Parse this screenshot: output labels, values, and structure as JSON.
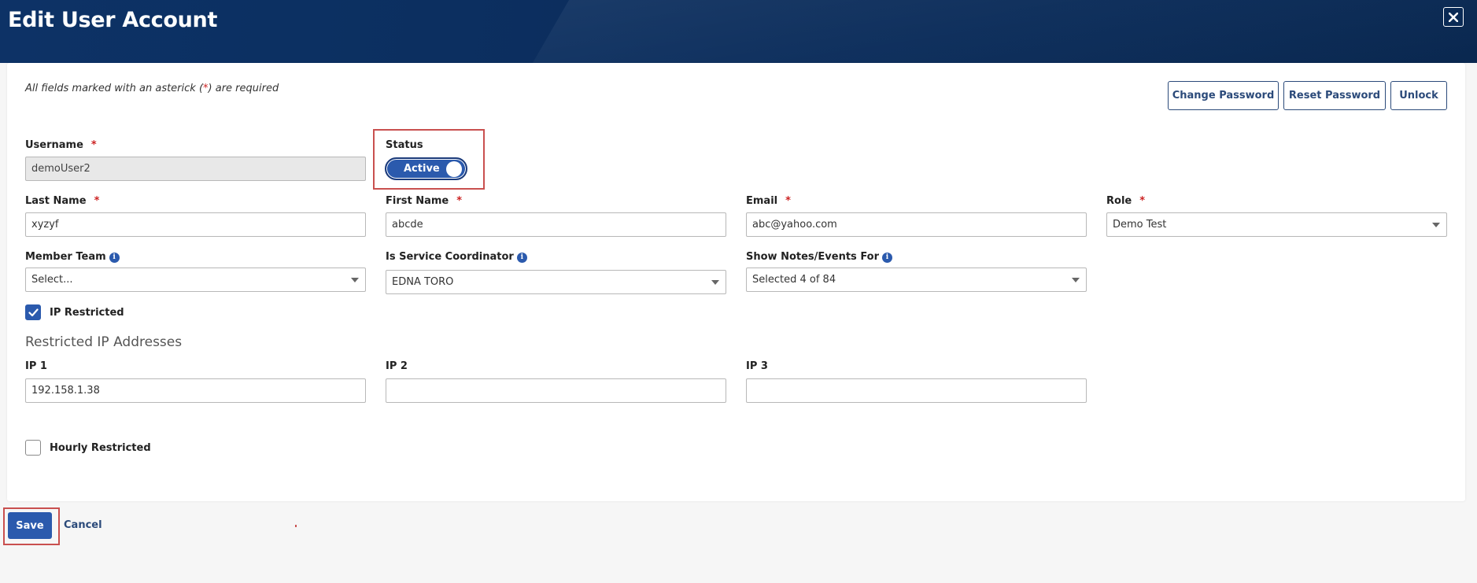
{
  "dialog": {
    "title": "Edit User Account"
  },
  "note": {
    "prefix": "All fields marked with an asterick (",
    "asterisk": "*",
    "suffix": ") are required"
  },
  "actions": {
    "change_password": "Change Password",
    "reset_password": "Reset Password",
    "unlock": "Unlock"
  },
  "fields": {
    "username": {
      "label": "Username",
      "value": "demoUser2"
    },
    "status": {
      "label": "Status",
      "value": "Active"
    },
    "last_name": {
      "label": "Last Name",
      "value": "xyzyf"
    },
    "first_name": {
      "label": "First Name",
      "value": "abcde"
    },
    "email": {
      "label": "Email",
      "value": "abc@yahoo.com"
    },
    "role": {
      "label": "Role",
      "value": "Demo Test"
    },
    "member_team": {
      "label": "Member Team",
      "value": "Select..."
    },
    "service_coordinator": {
      "label": "Is Service Coordinator",
      "value": "EDNA TORO"
    },
    "show_notes": {
      "label": "Show Notes/Events For",
      "value": "Selected 4 of 84"
    },
    "ip_restricted": {
      "label": "IP Restricted",
      "checked": true
    },
    "ip1": {
      "label": "IP 1",
      "value": "192.158.1.38"
    },
    "ip2": {
      "label": "IP 2",
      "value": ""
    },
    "ip3": {
      "label": "IP 3",
      "value": ""
    },
    "hourly_restricted": {
      "label": "Hourly Restricted",
      "checked": false
    }
  },
  "section": {
    "restricted_ip": "Restricted IP Addresses"
  },
  "required_mark": "*",
  "info_glyph": "i",
  "footer": {
    "save": "Save",
    "cancel": "Cancel"
  },
  "colors": {
    "header": "#0b2d5c",
    "primary": "#2b5aad",
    "highlight": "#c9504f",
    "required": "#cc2222"
  }
}
